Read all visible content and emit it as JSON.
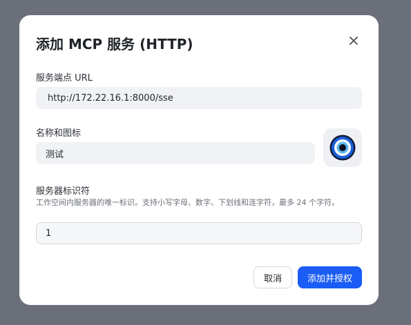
{
  "dialog": {
    "title": "添加 MCP 服务 (HTTP)"
  },
  "endpoint": {
    "label": "服务端点 URL",
    "value": "http://172.22.16.1:8000/sse"
  },
  "name_icon": {
    "label": "名称和图标",
    "value": "测试",
    "icon": "evil-eye-icon"
  },
  "server_id": {
    "label": "服务器标识符",
    "help": "工作空间内服务器的唯一标识。支持小写字母、数字、下划线和连字符，最多 24 个字符。",
    "value": "1"
  },
  "actions": {
    "cancel_label": "取消",
    "submit_label": "添加并授权",
    "submit_color": "#1a5cf5"
  },
  "icons": {
    "close": "close-icon"
  }
}
